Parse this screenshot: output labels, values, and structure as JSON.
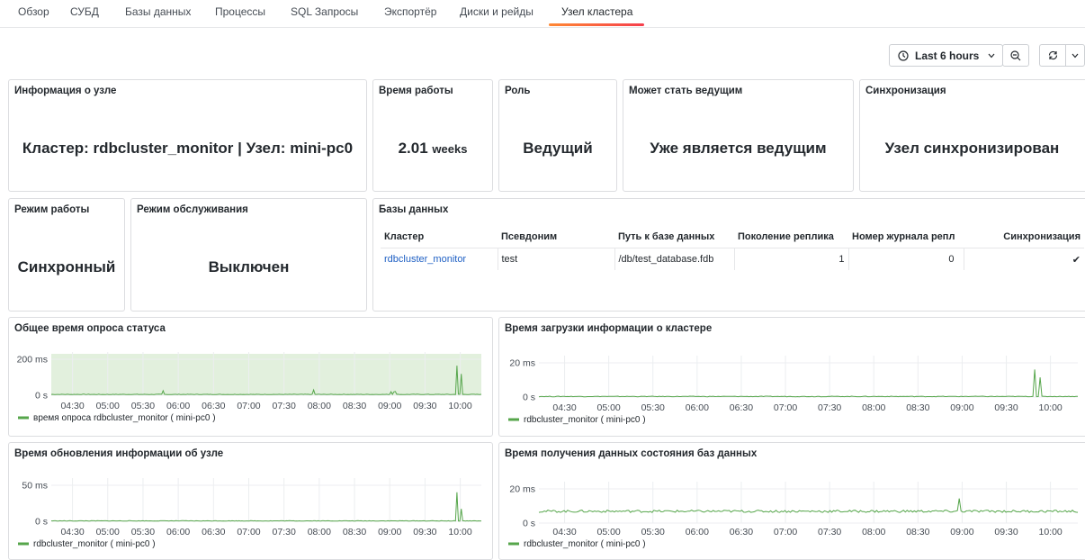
{
  "tabs": [
    "Обзор",
    "СУБД",
    "Базы данных",
    "Процессы",
    "SQL Запросы",
    "Экспортёр",
    "Диски и рейды",
    "Узел кластера"
  ],
  "toolbar": {
    "time_range": "Last 6 hours"
  },
  "panels": {
    "node_info": {
      "title": "Информация о узле",
      "value": "Кластер: rdbcluster_monitor | Узел: mini-pc0"
    },
    "uptime": {
      "title": "Время работы",
      "value": "2.01",
      "unit": "weeks"
    },
    "role": {
      "title": "Роль",
      "value": "Ведущий"
    },
    "can_lead": {
      "title": "Может стать ведущим",
      "value": "Уже является ведущим"
    },
    "sync": {
      "title": "Синхронизация",
      "value": "Узел синхронизирован"
    },
    "mode": {
      "title": "Режим работы",
      "value": "Синхронный"
    },
    "maint": {
      "title": "Режим обслуживания",
      "value": "Выключен"
    },
    "databases": {
      "title": "Базы данных",
      "columns": [
        "Кластер",
        "Псевдоним",
        "Путь к базе данных",
        "Поколение реплика",
        "Номер журнала репл",
        "Синхронизация"
      ],
      "rows": [
        {
          "cluster": "rdbcluster_monitor",
          "alias": "test",
          "path": "/db/test_database.fdb",
          "generation": "1",
          "journal": "0",
          "sync": "✔"
        }
      ]
    }
  },
  "colors": {
    "series": "#56a64b",
    "link": "#1f60c4",
    "tab_accent": "#ff7a33"
  },
  "chart_data": [
    {
      "type": "line",
      "title": "Общее время опроса статуса",
      "yticks": [
        "0 s",
        "200 ms"
      ],
      "yunits": "ms",
      "ylim": [
        0,
        280
      ],
      "x": [
        "04:30",
        "05:00",
        "05:30",
        "06:00",
        "06:30",
        "07:00",
        "07:30",
        "08:00",
        "08:30",
        "09:00",
        "09:30",
        "10:00"
      ],
      "threshold_region": true,
      "series": [
        {
          "name": "время опроса rdbcluster_monitor ( mini-pc0 )",
          "baseline": 7,
          "noise": 2,
          "spikes": [
            [
              0.26,
              38
            ],
            [
              0.61,
              45
            ],
            [
              0.79,
              30
            ],
            [
              0.795,
              28
            ],
            [
              0.8,
              32
            ],
            [
              0.945,
              250
            ],
            [
              0.955,
              180
            ]
          ]
        }
      ]
    },
    {
      "type": "line",
      "title": "Время загрузки информации о кластере",
      "yticks": [
        "0 s",
        "20 ms"
      ],
      "yunits": "ms",
      "ylim": [
        0,
        32
      ],
      "x": [
        "04:30",
        "05:00",
        "05:30",
        "06:00",
        "06:30",
        "07:00",
        "07:30",
        "08:00",
        "08:30",
        "09:00",
        "09:30",
        "10:00"
      ],
      "series": [
        {
          "name": "rdbcluster_monitor ( mini-pc0 )",
          "baseline": 0.6,
          "noise": 0.3,
          "spikes": [
            [
              0.92,
              28
            ],
            [
              0.93,
              20
            ]
          ]
        }
      ]
    },
    {
      "type": "line",
      "title": "Время обновления информации об узле",
      "yticks": [
        "0 s",
        "50 ms"
      ],
      "yunits": "ms",
      "ylim": [
        0,
        80
      ],
      "x": [
        "04:30",
        "05:00",
        "05:30",
        "06:00",
        "06:30",
        "07:00",
        "07:30",
        "08:00",
        "08:30",
        "09:00",
        "09:30",
        "10:00"
      ],
      "series": [
        {
          "name": "rdbcluster_monitor ( mini-pc0 )",
          "baseline": 1,
          "noise": 0.5,
          "spikes": [
            [
              0.945,
              70
            ],
            [
              0.955,
              30
            ]
          ]
        }
      ]
    },
    {
      "type": "line",
      "title": "Время получения данных состояния баз данных",
      "yticks": [
        "0 s",
        "20 ms"
      ],
      "yunits": "ms",
      "ylim": [
        0,
        32
      ],
      "x": [
        "04:30",
        "05:00",
        "05:30",
        "06:00",
        "06:30",
        "07:00",
        "07:30",
        "08:00",
        "08:30",
        "09:00",
        "09:30",
        "10:00"
      ],
      "series": [
        {
          "name": "rdbcluster_monitor ( mini-pc0 )",
          "baseline": 12,
          "noise": 1.2,
          "spikes": [
            [
              0.78,
              25
            ],
            [
              0.985,
              16
            ]
          ]
        }
      ]
    }
  ]
}
